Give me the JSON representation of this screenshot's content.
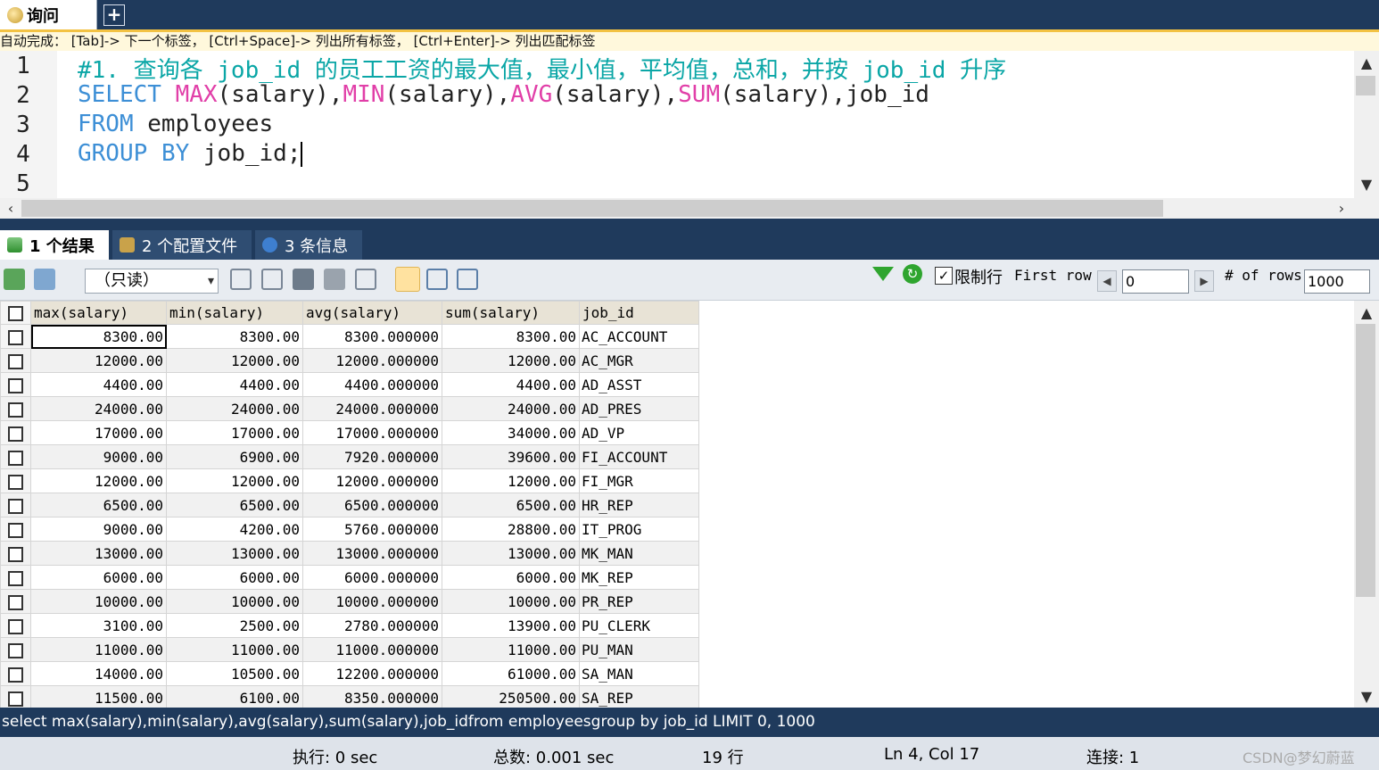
{
  "query_tab": {
    "label": "询问",
    "add_symbol": "+"
  },
  "autocomplete_hint": "自动完成： [Tab]-> 下一个标签， [Ctrl+Space]-> 列出所有标签， [Ctrl+Enter]-> 列出匹配标签",
  "editor": {
    "line_numbers": [
      "1",
      "2",
      "3",
      "4",
      "5"
    ],
    "line1": {
      "comment": "#1. 查询各 job_id 的员工工资的最大值，最小值，平均值，总和，并按 job_id 升序"
    },
    "line2": {
      "kw_select": "SELECT",
      "fn_max": "MAX",
      "arg1": "(salary),",
      "fn_min": "MIN",
      "arg2": "(salary),",
      "fn_avg": "AVG",
      "arg3": "(salary),",
      "fn_sum": "SUM",
      "arg4": "(salary),job_id"
    },
    "line3": {
      "kw_from": "FROM",
      "table": " employees"
    },
    "line4": {
      "kw_group": "GROUP",
      "kw_by": "BY",
      "col": " job_id;"
    }
  },
  "result_tabs": [
    {
      "label": "1 个结果",
      "icon": "grid-result-icon"
    },
    {
      "label": "2 个配置文件",
      "icon": "profile-icon"
    },
    {
      "label": "3 条信息",
      "icon": "info-icon"
    }
  ],
  "toolbar": {
    "readonly_option": "（只读）",
    "limit_label": "限制行",
    "first_row_label": "First row",
    "first_row_value": "0",
    "rows_label": "# of rows",
    "rows_value": "1000"
  },
  "grid": {
    "columns": [
      "max(salary)",
      "min(salary)",
      "avg(salary)",
      "sum(salary)",
      "job_id"
    ],
    "rows": [
      [
        "8300.00",
        "8300.00",
        "8300.000000",
        "8300.00",
        "AC_ACCOUNT"
      ],
      [
        "12000.00",
        "12000.00",
        "12000.000000",
        "12000.00",
        "AC_MGR"
      ],
      [
        "4400.00",
        "4400.00",
        "4400.000000",
        "4400.00",
        "AD_ASST"
      ],
      [
        "24000.00",
        "24000.00",
        "24000.000000",
        "24000.00",
        "AD_PRES"
      ],
      [
        "17000.00",
        "17000.00",
        "17000.000000",
        "34000.00",
        "AD_VP"
      ],
      [
        "9000.00",
        "6900.00",
        "7920.000000",
        "39600.00",
        "FI_ACCOUNT"
      ],
      [
        "12000.00",
        "12000.00",
        "12000.000000",
        "12000.00",
        "FI_MGR"
      ],
      [
        "6500.00",
        "6500.00",
        "6500.000000",
        "6500.00",
        "HR_REP"
      ],
      [
        "9000.00",
        "4200.00",
        "5760.000000",
        "28800.00",
        "IT_PROG"
      ],
      [
        "13000.00",
        "13000.00",
        "13000.000000",
        "13000.00",
        "MK_MAN"
      ],
      [
        "6000.00",
        "6000.00",
        "6000.000000",
        "6000.00",
        "MK_REP"
      ],
      [
        "10000.00",
        "10000.00",
        "10000.000000",
        "10000.00",
        "PR_REP"
      ],
      [
        "3100.00",
        "2500.00",
        "2780.000000",
        "13900.00",
        "PU_CLERK"
      ],
      [
        "11000.00",
        "11000.00",
        "11000.000000",
        "11000.00",
        "PU_MAN"
      ],
      [
        "14000.00",
        "10500.00",
        "12200.000000",
        "61000.00",
        "SA_MAN"
      ],
      [
        "11500.00",
        "6100.00",
        "8350.000000",
        "250500.00",
        "SA_REP"
      ]
    ]
  },
  "sql_bar": "select max(salary),min(salary),avg(salary),sum(salary),job_idfrom employeesgroup by job_id LIMIT 0, 1000",
  "status": {
    "exec": "执行: 0 sec",
    "total": "总数: 0.001 sec",
    "rows": "19 行",
    "position": "Ln 4, Col 17",
    "connection": "连接: 1",
    "watermark": "CSDN@梦幻蔚蓝"
  },
  "colors": {
    "dark_bar": "#1f3a5c",
    "comment": "#0aa6a6",
    "keyword": "#3d8fd6",
    "function": "#e13fa8"
  }
}
